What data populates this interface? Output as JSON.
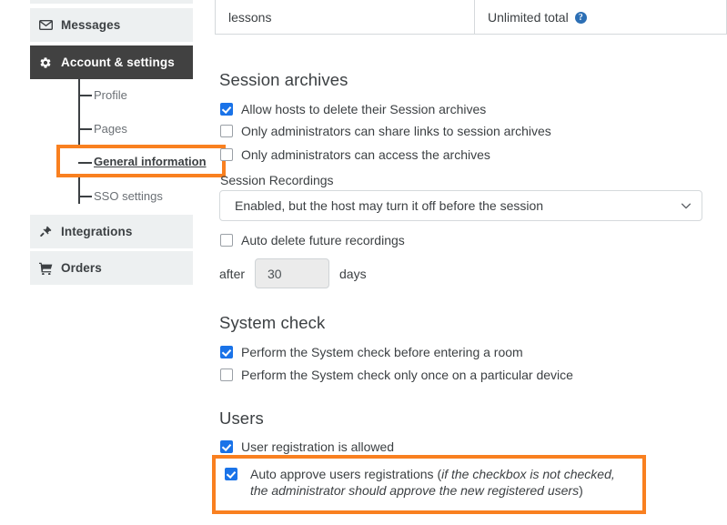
{
  "sidebar": {
    "items": [
      {
        "id": "partial",
        "label": "",
        "icon": "",
        "active": false
      },
      {
        "id": "messages",
        "label": "Messages",
        "icon": "envelope-icon",
        "active": false
      },
      {
        "id": "account",
        "label": "Account & settings",
        "icon": "gear-icon",
        "active": true
      },
      {
        "id": "integrations",
        "label": "Integrations",
        "icon": "plug-icon",
        "active": false
      },
      {
        "id": "orders",
        "label": "Orders",
        "icon": "cart-icon",
        "active": false
      }
    ],
    "sub_items": [
      {
        "id": "profile",
        "label": "Profile",
        "current": false
      },
      {
        "id": "pages",
        "label": "Pages",
        "current": false
      },
      {
        "id": "general",
        "label": "General information",
        "current": true
      },
      {
        "id": "sso",
        "label": "SSO settings",
        "current": false
      }
    ]
  },
  "table": {
    "feature": "lessons",
    "limit": "Unlimited total",
    "help_icon": "?"
  },
  "sections": {
    "session_archives": {
      "title": "Session archives",
      "checkboxes": [
        {
          "label": "Allow hosts to delete their Session archives",
          "checked": true
        },
        {
          "label": "Only administrators can share links to session archives",
          "checked": false
        },
        {
          "label": "Only administrators can access the archives",
          "checked": false
        }
      ],
      "recordings_label": "Session Recordings",
      "recordings_value": "Enabled, but the host may turn it off before the session",
      "auto_delete": {
        "label": "Auto delete future recordings",
        "checked": false
      },
      "after_label": "after",
      "days_value": "30",
      "days_label": "days"
    },
    "system_check": {
      "title": "System check",
      "checkboxes": [
        {
          "label": "Perform the System check before entering a room",
          "checked": true
        },
        {
          "label": "Perform the System check only once on a particular device",
          "checked": false
        }
      ]
    },
    "users": {
      "title": "Users",
      "checkboxes": [
        {
          "label": "User registration is allowed",
          "checked": true
        }
      ],
      "auto_approve": {
        "prefix": "Auto approve users registrations (",
        "italic": "if the checkbox is not checked, the administrator should approve the new registered users",
        "suffix": ")",
        "checked": true
      }
    }
  },
  "colors": {
    "highlight": "#f98020",
    "accent_checkbox": "#1a73e8",
    "sidebar_active_bg": "#414141",
    "sidebar_bg": "#edf0f1"
  }
}
